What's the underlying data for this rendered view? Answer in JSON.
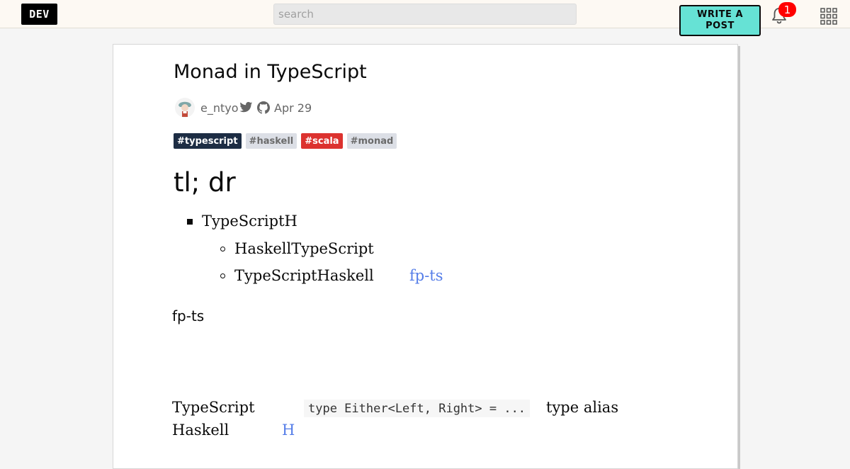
{
  "header": {
    "logo": "DEV",
    "search_placeholder": "search",
    "write_post_label": "WRITE A POST",
    "notification_count": "1",
    "icons": [
      "bell-icon",
      "apps-grid-icon"
    ]
  },
  "article": {
    "title": "Monad in TypeScript",
    "author": "e_ntyo",
    "date": "Apr 29",
    "tags": [
      {
        "label": "#typescript",
        "bg": "#1d2d44",
        "fg": "#ffffff"
      },
      {
        "label": "#haskell",
        "bg": "#dcdfe6",
        "fg": "#6b6b6b"
      },
      {
        "label": "#scala",
        "bg": "#dc322f",
        "fg": "#ffffff"
      },
      {
        "label": "#monad",
        "bg": "#dcdfe6",
        "fg": "#6b6b6b"
      }
    ],
    "heading": "tl; dr",
    "list": {
      "item1": "TypeScriptH",
      "sub1": "HaskellTypeScript",
      "sub2": "TypeScriptHaskell",
      "sub2_link": "fp-ts"
    },
    "paragraph": "fp-ts",
    "line1_text": "TypeScript",
    "line1_code": "type Either<Left, Right> = ...",
    "line1_after": "type alias",
    "line2_text": "Haskell",
    "line2_link": "H"
  },
  "colors": {
    "accent": "#66e2d5",
    "link": "#557de8",
    "badge": "#ff0000"
  }
}
